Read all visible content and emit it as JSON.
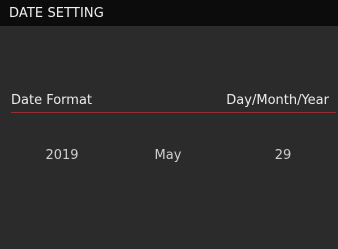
{
  "header": {
    "title": "DATE SETTING"
  },
  "date_format": {
    "label": "Date Format",
    "value": "Day/Month/Year"
  },
  "date_fields": {
    "year": "2019",
    "month": "May",
    "day": "29"
  },
  "colors": {
    "screen_background": "#2b2b2b",
    "header_background": "#0c0c0c",
    "divider_accent": "#9e2a2a",
    "text": "#e6e6e6"
  }
}
